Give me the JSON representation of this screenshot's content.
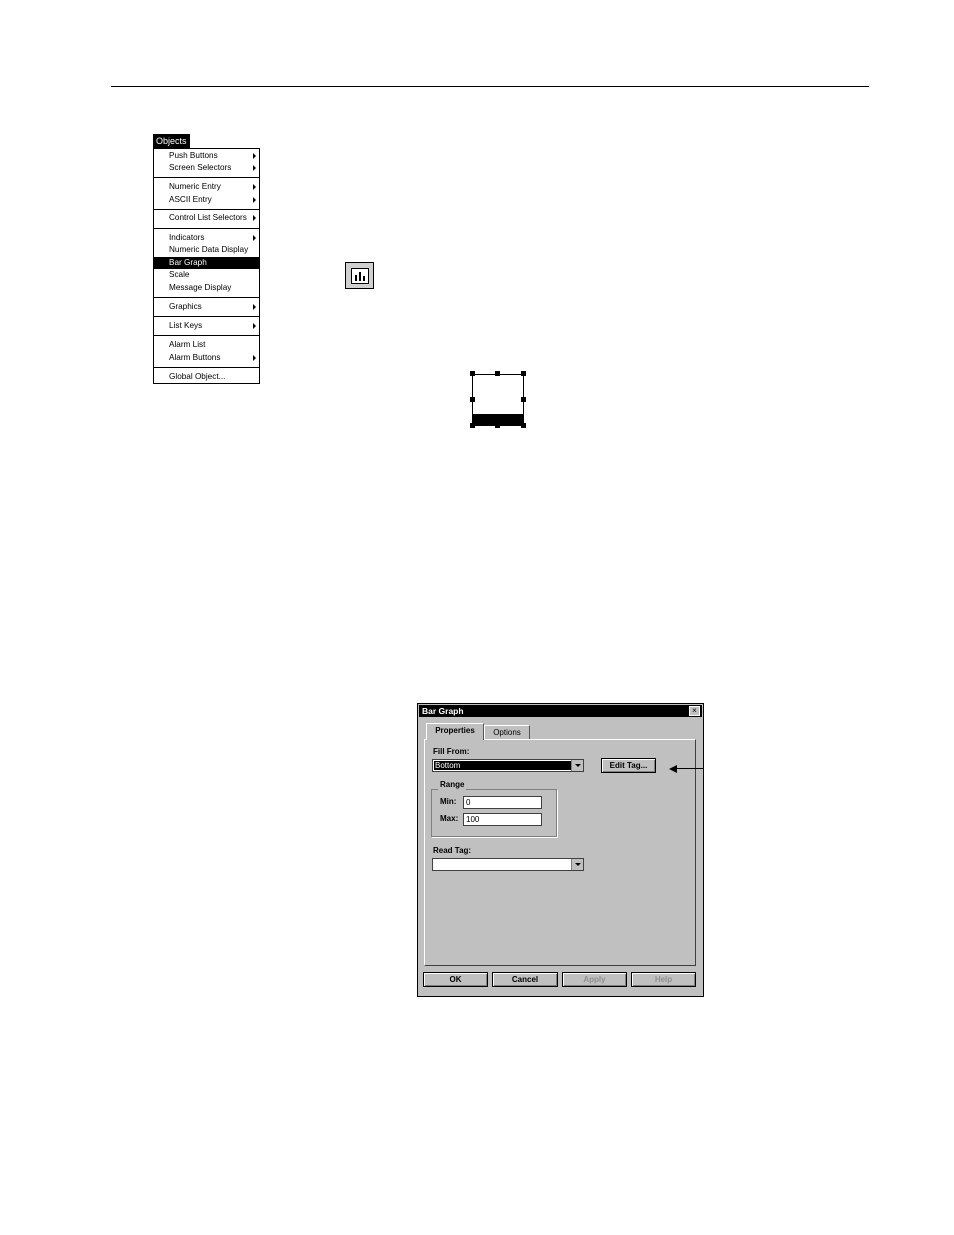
{
  "menu": {
    "title": "Objects",
    "items": [
      {
        "label": "Push Buttons",
        "submenu": true
      },
      {
        "label": "Screen Selectors",
        "submenu": true
      },
      {
        "label": "Numeric Entry",
        "submenu": true
      },
      {
        "label": "ASCII Entry",
        "submenu": true
      },
      {
        "label": "Control List Selectors",
        "submenu": true
      },
      {
        "label": "Indicators",
        "submenu": true
      },
      {
        "label": "Numeric Data Display",
        "submenu": false
      },
      {
        "label": "Bar Graph",
        "submenu": false,
        "selected": true
      },
      {
        "label": "Scale",
        "submenu": false
      },
      {
        "label": "Message Display",
        "submenu": false
      },
      {
        "label": "Graphics",
        "submenu": true
      },
      {
        "label": "List Keys",
        "submenu": true
      },
      {
        "label": "Alarm List",
        "submenu": false
      },
      {
        "label": "Alarm Buttons",
        "submenu": true
      },
      {
        "label": "Global Object...",
        "submenu": false
      }
    ]
  },
  "toolbar_icon": {
    "icon": "bar-graph-tool-icon"
  },
  "bar_graph_object": {
    "fill_level": 0.23
  },
  "dialog": {
    "title": "Bar Graph",
    "close_label": "×",
    "tabs": [
      "Properties",
      "Options"
    ],
    "active_tab": "Properties",
    "fill_from_label": "Fill From:",
    "fill_from_value": "Bottom",
    "edit_tag_label": "Edit Tag...",
    "range_label": "Range",
    "min_label": "Min:",
    "min_value": "0",
    "max_label": "Max:",
    "max_value": "100",
    "read_tag_label": "Read Tag:",
    "read_tag_value": "",
    "buttons": {
      "ok": "OK",
      "cancel": "Cancel",
      "apply": "Apply",
      "help": "Help"
    }
  }
}
